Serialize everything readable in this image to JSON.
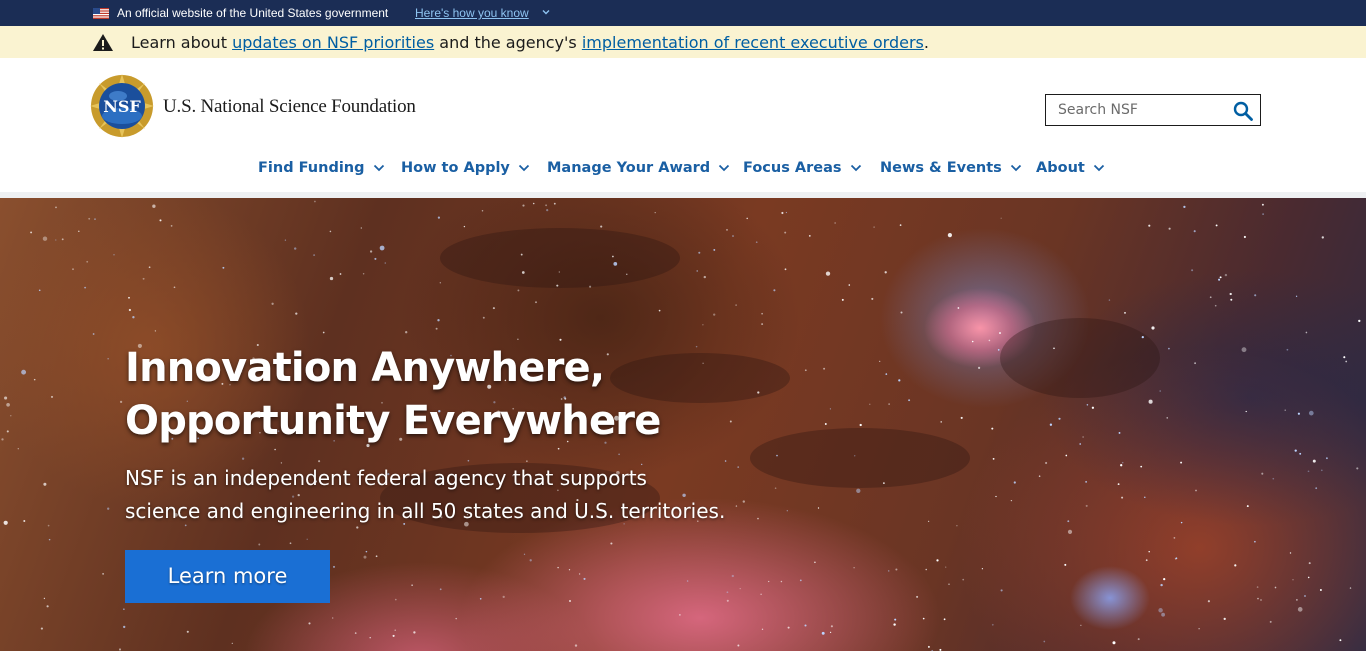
{
  "gov_banner": {
    "text": "An official website of the United States government",
    "link": "Here's how you know",
    "flag_icon": "us-flag-icon"
  },
  "alert": {
    "prefix": "Learn about ",
    "link1": "updates on NSF priorities",
    "middle": " and the agency's ",
    "link2": "implementation of recent executive orders",
    "suffix": ".",
    "icon": "warning-icon"
  },
  "header": {
    "logo_text": "NSF",
    "site_name": "U.S. National Science Foundation",
    "search_placeholder": "Search NSF",
    "search_icon": "search-icon"
  },
  "nav": {
    "items": [
      {
        "label": "Find Funding"
      },
      {
        "label": "How to Apply"
      },
      {
        "label": "Manage Your Award"
      },
      {
        "label": "Focus Areas"
      },
      {
        "label": "News & Events"
      },
      {
        "label": "About"
      }
    ],
    "accent_color": "#1a5fa3"
  },
  "hero": {
    "title_line1": "Innovation Anywhere,",
    "title_line2": "Opportunity Everywhere",
    "desc_line1": "NSF is an independent federal agency that supports",
    "desc_line2": "science and engineering in all 50 states and U.S. territories.",
    "button": "Learn more",
    "button_color": "#1a6fd4"
  },
  "colors": {
    "gov_banner_bg": "#1b2d55",
    "alert_bg": "#faf3d1",
    "link": "#005ea2"
  }
}
